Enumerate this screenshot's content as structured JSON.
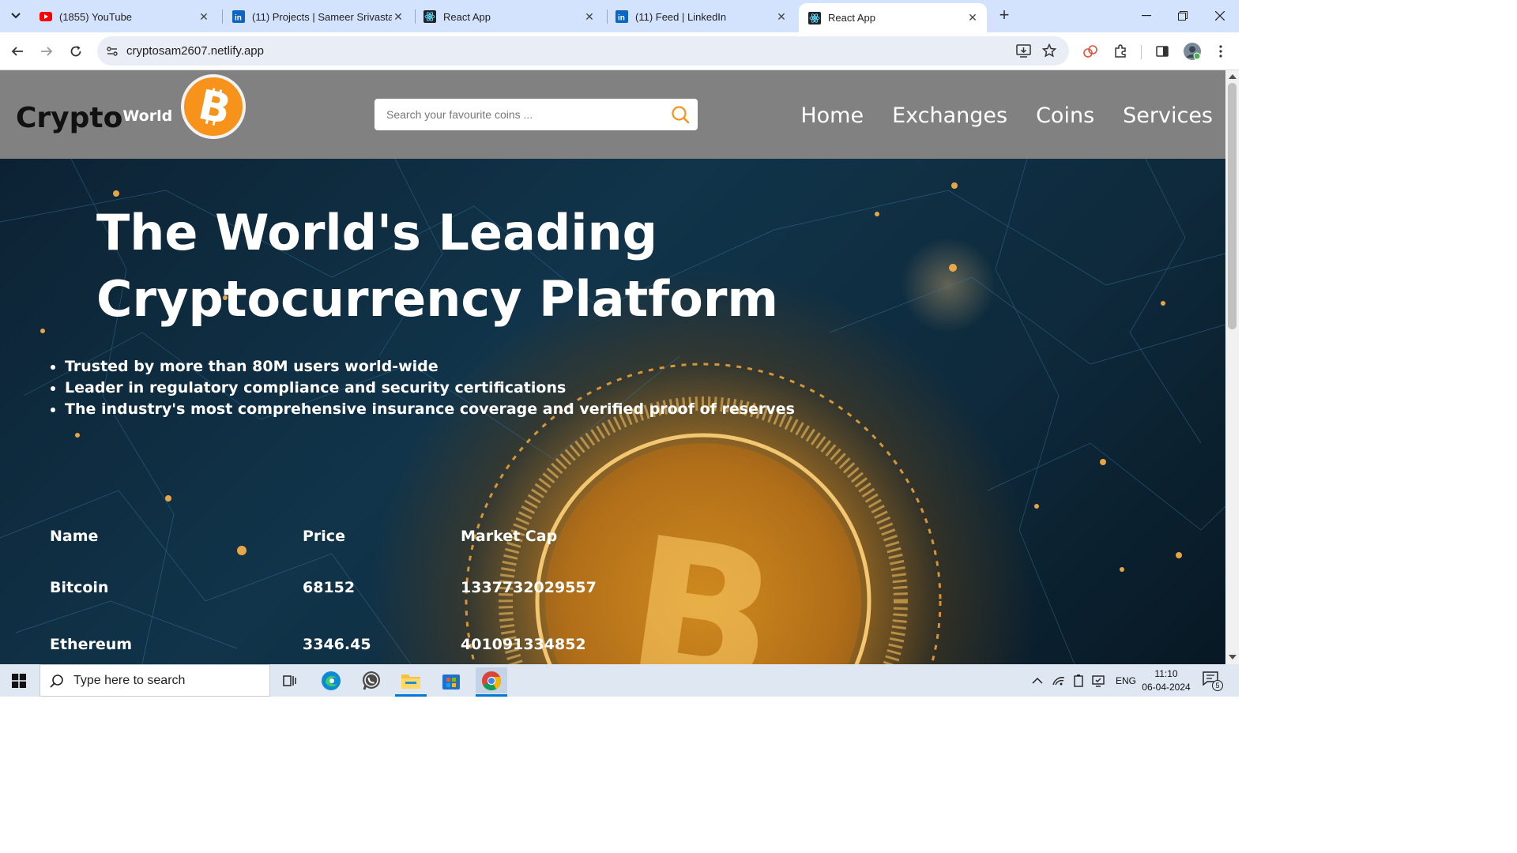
{
  "browser": {
    "tabs": [
      {
        "title": "(1855) YouTube",
        "icon": "youtube-icon"
      },
      {
        "title": "(11) Projects | Sameer Srivastava",
        "icon": "linkedin-icon"
      },
      {
        "title": "React App",
        "icon": "react-icon"
      },
      {
        "title": "(11) Feed | LinkedIn",
        "icon": "linkedin-icon"
      },
      {
        "title": "React App",
        "icon": "react-icon",
        "active": true
      }
    ],
    "url": "cryptosam2607.netlify.app"
  },
  "site": {
    "brand": "Crypto",
    "brand_suffix": "World",
    "search_placeholder": "Search your favourite coins ...",
    "nav": [
      "Home",
      "Exchanges",
      "Coins",
      "Services"
    ],
    "hero_title": "The World's Leading Cryptocurrency Platform",
    "bullets": [
      "Trusted by more than 80M users world-wide",
      "Leader in regulatory compliance and security certifications",
      "The industry's most comprehensive insurance coverage and verified proof of reserves"
    ],
    "table": {
      "headers": [
        "Name",
        "Price",
        "Market Cap"
      ],
      "rows": [
        [
          "Bitcoin",
          "68152",
          "1337732029557"
        ],
        [
          "Ethereum",
          "3346.45",
          "401091334852"
        ]
      ]
    }
  },
  "taskbar": {
    "search_placeholder": "Type here to search",
    "language": "ENG",
    "time": "11:10",
    "date": "06-04-2024",
    "notification_count": "5"
  },
  "colors": {
    "tabstrip": "#d3e3fd",
    "navbar": "#818181",
    "bitcoin_orange": "#f7931a"
  }
}
